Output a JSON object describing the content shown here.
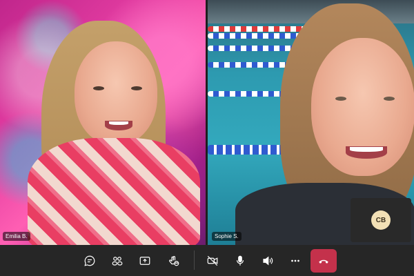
{
  "participants": [
    {
      "name": "Emilia B."
    },
    {
      "name": "Sophie S."
    }
  ],
  "self_view": {
    "initials": "CB"
  },
  "toolbar": {
    "icons": [
      "chat-icon",
      "people-icon",
      "share-screen-icon",
      "reactions-icon",
      "camera-off-icon",
      "microphone-icon",
      "speaker-icon",
      "more-icon",
      "hang-up-icon"
    ],
    "leave_color": "#c4314b",
    "bar_color": "#262626"
  },
  "colors": {
    "left_background": "#e03a9f",
    "right_background": "#33a9bd",
    "avatar": "#f2e0b5"
  }
}
